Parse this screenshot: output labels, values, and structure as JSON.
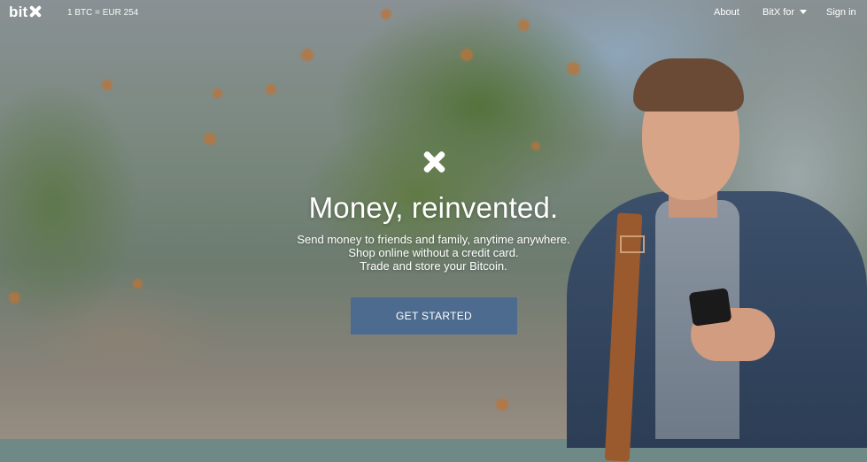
{
  "nav": {
    "logo_text": "bit",
    "rate": "1 BTC = EUR 254",
    "links": {
      "about": "About",
      "bitx_for": "BitX for",
      "sign_in": "Sign in"
    }
  },
  "hero": {
    "title": "Money, reinvented.",
    "subtitle_lines": [
      "Send money to friends and family, anytime anywhere.",
      "Shop online without a credit card.",
      "Trade and store your Bitcoin."
    ],
    "cta_label": "GET STARTED"
  },
  "colors": {
    "cta_bg": "#4d6b8f",
    "text": "#ffffff"
  },
  "icons": {
    "logo_mark": "bitx-x-icon",
    "dropdown": "caret-down-icon"
  }
}
